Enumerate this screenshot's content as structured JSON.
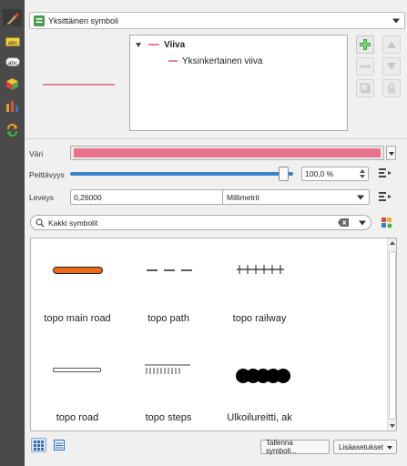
{
  "symbol_type": {
    "value": "Yksittäinen symboli"
  },
  "tree": {
    "root_label": "Viiva",
    "child_label": "Yksinkertainen viiva"
  },
  "properties": {
    "color_label": "Väri",
    "color_value": "#e8728a",
    "opacity_label": "Peittävyys",
    "opacity_value": "100,0 %",
    "opacity_level": 0.98,
    "width_label": "Leveys",
    "width_value": "0,26000",
    "unit_value": "Millimetrit"
  },
  "library": {
    "search_placeholder": "Kakki symbolit",
    "symbols": [
      {
        "name": "topo main road"
      },
      {
        "name": "topo path"
      },
      {
        "name": "topo railway"
      },
      {
        "name": "topo road"
      },
      {
        "name": "topo steps"
      },
      {
        "name": "Ulkoilureitti, ak"
      }
    ]
  },
  "footer": {
    "save_label": "Tallenna symboli...",
    "advanced_label": "Lisäasetukset"
  },
  "colors": {
    "accent_blue": "#3c82c8",
    "line_pink": "#e8829a",
    "main_road_fill": "#f06a1a"
  }
}
